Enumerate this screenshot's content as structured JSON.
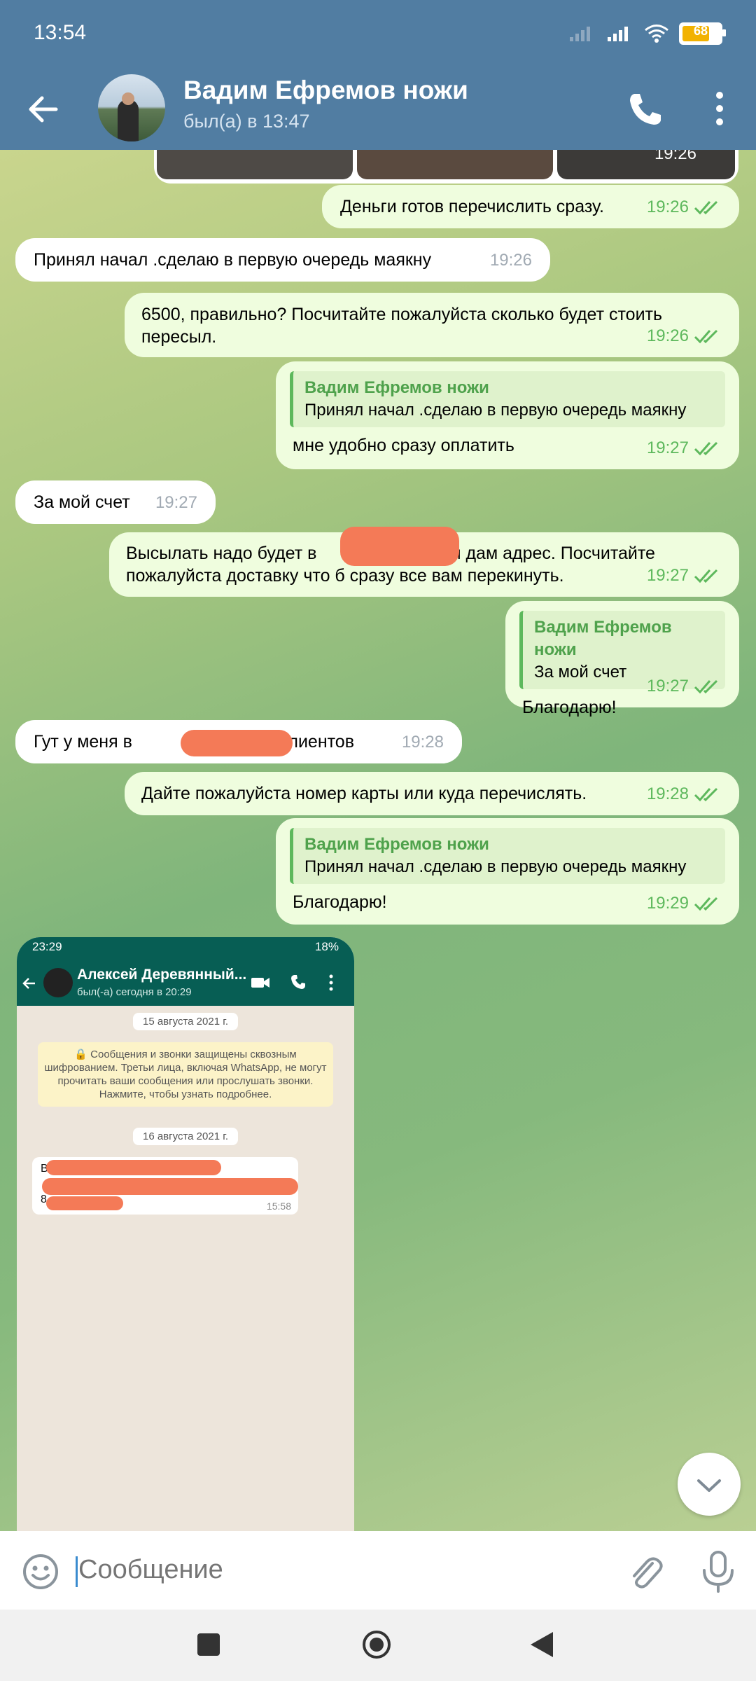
{
  "status_bar": {
    "time": "13:54",
    "battery": "68"
  },
  "header": {
    "title": "Вадим Ефремов ножи",
    "subtitle": "был(а) в 13:47"
  },
  "media": {
    "time": "19:26"
  },
  "messages": [
    {
      "text": "Деньги готов перечислить сразу.",
      "time": "19:26"
    },
    {
      "text": "Принял начал .сделаю в первую очередь маякну",
      "time": "19:26"
    },
    {
      "text": "6500, правильно? Посчитайте пожалуйста сколько будет стоить пересыл.",
      "time": "19:26"
    },
    {
      "reply_name": "Вадим Ефремов ножи",
      "reply_text": "Принял начал .сделаю в первую очередь маякну",
      "text": "мне удобно сразу оплатить",
      "time": "19:27"
    },
    {
      "text": "За мой счет",
      "time": "19:27"
    },
    {
      "text_a": "Высылать надо будет в ",
      "text_b": "потом дам адрес. Посчитайте",
      "text_c": "пожалуйста доставку что б сразу все вам перекинуть.",
      "time": "19:27"
    },
    {
      "reply_name": "Вадим Ефремов ножи",
      "reply_text": "За мой счет",
      "text": "Благодарю!",
      "time": "19:27"
    },
    {
      "text_a": "Гут у меня в ",
      "text_b": "много клиентов",
      "time": "19:28"
    },
    {
      "text": "Дайте пожалуйста номер карты или куда перечислять.",
      "time": "19:28"
    },
    {
      "reply_name": "Вадим Ефремов ножи",
      "reply_text": "Принял начал .сделаю в первую очередь маякну",
      "text": "Благодарю!",
      "time": "19:29"
    }
  ],
  "screenshot": {
    "time": "23:29",
    "battery": "18%",
    "name": "Алексей Деревянный...",
    "seen": "был(-а) сегодня в 20:29",
    "date1": "15 августа 2021 г.",
    "notice": "🔒 Сообщения и звонки защищены сквозным шифрованием. Третьи лица, включая WhatsApp, не могут прочитать ваши сообщения или прослушать звонки. Нажмите, чтобы узнать подробнее.",
    "date2": "16 августа 2021 г.",
    "msg_a": "В",
    "msg_b": "8",
    "msg_time": "15:58"
  },
  "input": {
    "placeholder": "Сообщение"
  },
  "colors": {
    "header": "#517DA2",
    "outgoing": "#EFFDDE",
    "incoming": "#FFFFFF",
    "check": "#5DB85C"
  }
}
